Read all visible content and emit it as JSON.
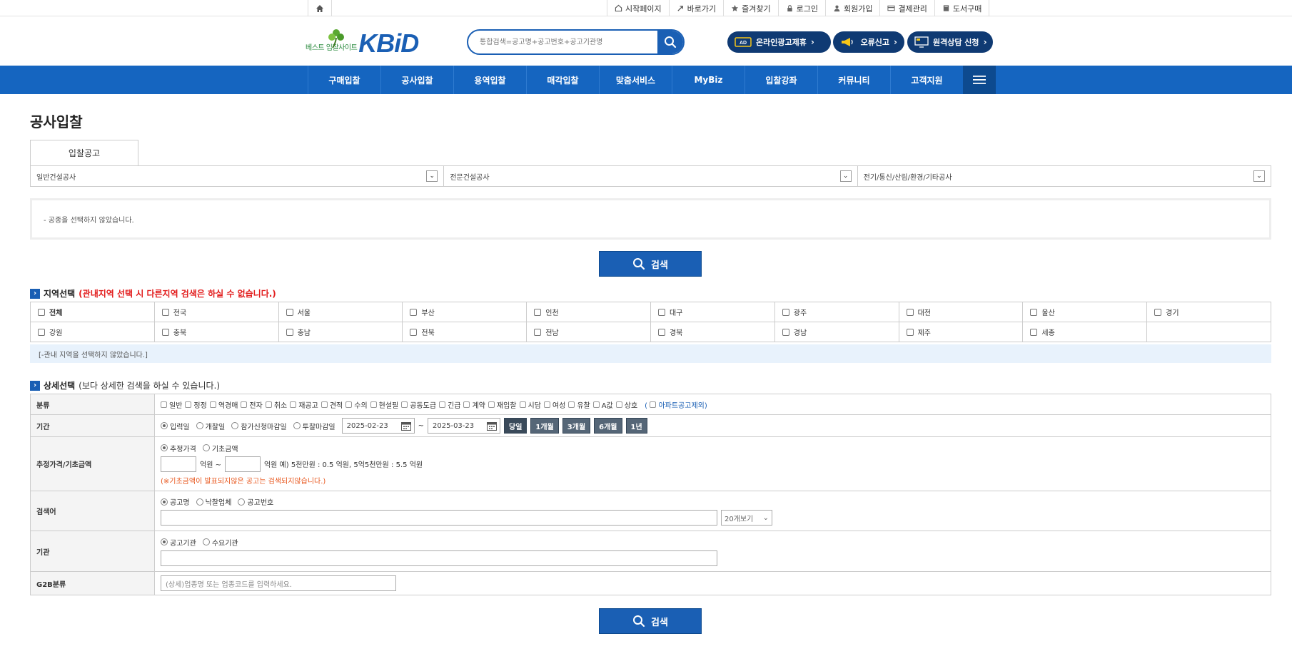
{
  "util_bar": {
    "links": [
      {
        "label": "시작페이지",
        "icon": "home-outline-icon"
      },
      {
        "label": "바로가기",
        "icon": "shortcut-icon"
      },
      {
        "label": "즐겨찾기",
        "icon": "star-icon"
      },
      {
        "label": "로그인",
        "icon": "lock-icon"
      },
      {
        "label": "회원가입",
        "icon": "user-icon"
      },
      {
        "label": "결제관리",
        "icon": "card-icon"
      },
      {
        "label": "도서구매",
        "icon": "book-icon"
      }
    ]
  },
  "header": {
    "logo_text": "KBiD",
    "logo_sub": "베스트 입찰사이트",
    "search_placeholder": "통합검색=공고명+공고번호+공고기관명",
    "buttons": [
      "온라인광고제휴",
      "오류신고",
      "원격상담 신청"
    ]
  },
  "nav": {
    "items": [
      "구매입찰",
      "공사입찰",
      "용역입찰",
      "매각입찰",
      "맞춤서비스",
      "MyBiz",
      "입찰강좌",
      "커뮤니티",
      "고객지원"
    ]
  },
  "page": {
    "title": "공사입찰",
    "tab": "입찰공고",
    "categories": [
      "일반건설공사",
      "전문건설공사",
      "전기/통신/산림/환경/기타공사"
    ],
    "notice": "- 공종을 선택하지 않았습니다.",
    "search_button": "검색"
  },
  "region": {
    "title": "지역선택",
    "title_note": "(관내지역 선택 시 다른지역 검색은 하실 수 없습니다.)",
    "row1": [
      "전체",
      "전국",
      "서울",
      "부산",
      "인천",
      "대구",
      "광주",
      "대전",
      "울산",
      "경기"
    ],
    "row2": [
      "강원",
      "충북",
      "충남",
      "전북",
      "전남",
      "경북",
      "경남",
      "제주",
      "세종"
    ],
    "note": "[-관내 지역을 선택하지 않았습니다.]"
  },
  "detail": {
    "title": "상세선택",
    "title_note": "(보다 상세한 검색을 하실 수 있습니다.)",
    "rows": {
      "classification": {
        "label": "분류",
        "options": [
          "일반",
          "정정",
          "역경매",
          "전자",
          "취소",
          "재공고",
          "견적",
          "수의",
          "현설필",
          "공동도급",
          "긴급",
          "계약",
          "재입찰",
          "시담",
          "여성",
          "유찰",
          "A값",
          "상호"
        ],
        "apt_link": "아파트공고제외"
      },
      "period": {
        "label": "기간",
        "radios": [
          "입력일",
          "개찰일",
          "참가신청마감일",
          "투찰마감일"
        ],
        "date_from": "2025-02-23",
        "date_to": "2025-03-23",
        "separator": "~",
        "buttons": [
          "당일",
          "1개월",
          "3개월",
          "6개월",
          "1년"
        ]
      },
      "price": {
        "label": "추정가격/기초금액",
        "radios": [
          "추정가격",
          "기초금액"
        ],
        "unit1": "억원 ~",
        "unit2": "억원 예) 5천만원 : 0.5 억원, 5억5천만원 : 5.5 억원",
        "warning": "(※기초금액이 발표되지않은 공고는 검색되지않습니다.)"
      },
      "keyword": {
        "label": "검색어",
        "radios": [
          "공고명",
          "낙찰업체",
          "공고번호"
        ],
        "select": "20개보기"
      },
      "agency": {
        "label": "기관",
        "radios": [
          "공고기관",
          "수요기관"
        ]
      },
      "g2b": {
        "label": "G2B분류",
        "placeholder": "(상세)업종명 또는 업종코드를 입력하세요."
      }
    }
  },
  "colors": {
    "brand_blue": "#1565c0",
    "dark_navy": "#0f3a73",
    "red_note": "#e21c1c"
  }
}
